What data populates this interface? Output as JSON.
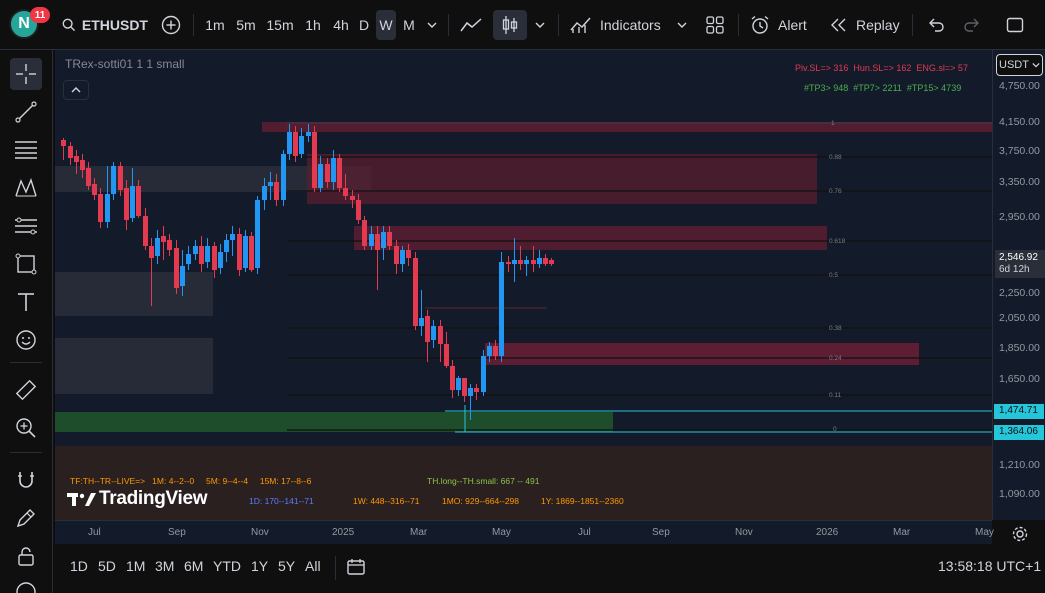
{
  "topbar": {
    "avatar_letter": "N",
    "notifications": "11",
    "symbol": "ETHUSDT",
    "intervals": [
      "1m",
      "5m",
      "15m",
      "1h",
      "4h",
      "D",
      "W",
      "M"
    ],
    "active_interval": "W",
    "indicators_label": "Indicators",
    "alert_label": "Alert",
    "replay_label": "Replay"
  },
  "chart": {
    "indicator_name": "TRex-sotti01 1 1 small",
    "legend_line1": "Piv.SL=> 316  Hun.SL=> 162  ENG.sl=> 57",
    "legend_line2": "#TP3> 948  #TP7> 2211  #TP15> 4739",
    "tf_line": "TF:TH--TR--LIVE=>   1M: 4--2--0     5M: 9--4--4     15M: 17--8--6",
    "th_line": "TH.long--TH.small: 667 -- 491",
    "d_line": "1D: 170--141--71",
    "w_line": "1W: 448--316--71",
    "mo_line": "1MO: 929--664--298",
    "y_line": "1Y: 1869--1851--2360",
    "watermark": "TradingView",
    "fib_labels": [
      "1",
      "0.88",
      "0.76",
      "0.618",
      "0.5",
      "0.38",
      "0.24",
      "0.11",
      "0"
    ]
  },
  "price_axis": {
    "currency": "USDT",
    "ticks": [
      "4,750.00",
      "4,150.00",
      "3,750.00",
      "3,350.00",
      "2,950.00",
      "2,250.00",
      "2,050.00",
      "1,850.00",
      "1,650.00",
      "1,210.00",
      "1,090.00"
    ],
    "last_price": "2,546.92",
    "countdown": "6d 12h",
    "level_a": "1,474.71",
    "level_b": "1,364.06"
  },
  "time_axis": {
    "labels": [
      "Jul",
      "Sep",
      "Nov",
      "2025",
      "Mar",
      "May",
      "Jul",
      "Sep",
      "Nov",
      "2026",
      "Mar",
      "May"
    ]
  },
  "bottombar": {
    "ranges": [
      "1D",
      "5D",
      "1M",
      "3M",
      "6M",
      "YTD",
      "1Y",
      "5Y",
      "All"
    ],
    "clock": "13:58:18 UTC+1"
  },
  "colors": {
    "up": "#2196f3",
    "down": "#e33a4f",
    "cyan_line": "#26c6da",
    "green_zone": "#1e4d2b",
    "bg": "#131a2a"
  }
}
